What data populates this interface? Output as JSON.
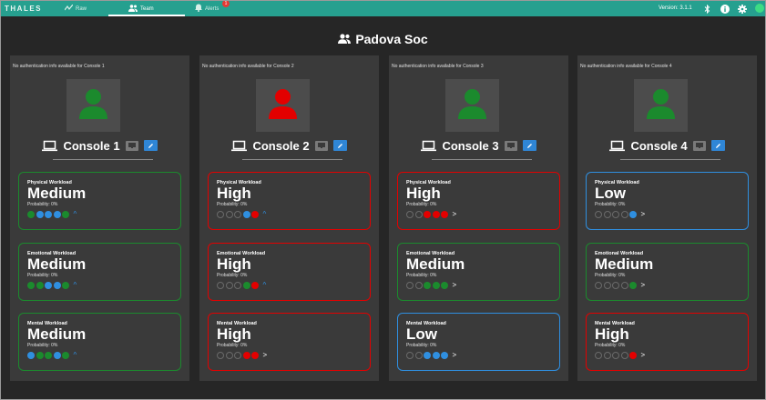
{
  "topbar": {
    "logo": "THALES",
    "tabs": [
      {
        "label": "Raw",
        "icon": "raw-icon"
      },
      {
        "label": "Team",
        "icon": "team-icon"
      },
      {
        "label": "Alerts",
        "icon": "bell-icon",
        "badge": "1"
      }
    ],
    "version": "Version: 3.1.1"
  },
  "page": {
    "title": "Padova Soc"
  },
  "colors": {
    "green": "#1b8a2d",
    "red": "#e30000",
    "blue": "#2f8fe0",
    "accent": "#26a08f"
  },
  "consoles": [
    {
      "auth": "No authentication info available for Console 1",
      "name": "Console 1",
      "avatar_color": "#1b8a2d",
      "workloads": [
        {
          "label": "Physical Workload",
          "value": "Medium",
          "prob": "Probability: 0%",
          "color": "#1b8a2d",
          "dots": [
            "#1b8a2d",
            "#2f8fe0",
            "#2f8fe0",
            "#2f8fe0",
            "#1b8a2d"
          ],
          "trend": "^"
        },
        {
          "label": "Emotional Workload",
          "value": "Medium",
          "prob": "Probability: 0%",
          "color": "#1b8a2d",
          "dots": [
            "#1b8a2d",
            "#1b8a2d",
            "#2f8fe0",
            "#2f8fe0",
            "#1b8a2d"
          ],
          "trend": "^"
        },
        {
          "label": "Mental Workload",
          "value": "Medium",
          "prob": "Probability: 0%",
          "color": "#1b8a2d",
          "dots": [
            "#2f8fe0",
            "#1b8a2d",
            "#1b8a2d",
            "#2f8fe0",
            "#1b8a2d"
          ],
          "trend": "^"
        }
      ]
    },
    {
      "auth": "No authentication info available for Console 2",
      "name": "Console 2",
      "avatar_color": "#e30000",
      "workloads": [
        {
          "label": "Physical Workload",
          "value": "High",
          "prob": "Probability: 0%",
          "color": "#e30000",
          "dots": [
            "off",
            "off",
            "off",
            "#2f8fe0",
            "#e30000"
          ],
          "trend": "^"
        },
        {
          "label": "Emotional Workload",
          "value": "High",
          "prob": "Probability: 0%",
          "color": "#e30000",
          "dots": [
            "off",
            "off",
            "off",
            "#1b8a2d",
            "#e30000"
          ],
          "trend": "^"
        },
        {
          "label": "Mental Workload",
          "value": "High",
          "prob": "Probability: 0%",
          "color": "#e30000",
          "dots": [
            "off",
            "off",
            "off",
            "#e30000",
            "#e30000"
          ],
          "trend": ">"
        }
      ]
    },
    {
      "auth": "No authentication info available for Console 3",
      "name": "Console 3",
      "avatar_color": "#1b8a2d",
      "workloads": [
        {
          "label": "Physical Workload",
          "value": "High",
          "prob": "Probability: 0%",
          "color": "#e30000",
          "dots": [
            "off",
            "off",
            "#e30000",
            "#e30000",
            "#e30000"
          ],
          "trend": ">"
        },
        {
          "label": "Emotional Workload",
          "value": "Medium",
          "prob": "Probability: 0%",
          "color": "#1b8a2d",
          "dots": [
            "off",
            "off",
            "#1b8a2d",
            "#1b8a2d",
            "#1b8a2d"
          ],
          "trend": ">"
        },
        {
          "label": "Mental Workload",
          "value": "Low",
          "prob": "Probability: 0%",
          "color": "#2f8fe0",
          "dots": [
            "off",
            "off",
            "#2f8fe0",
            "#2f8fe0",
            "#2f8fe0"
          ],
          "trend": ">"
        }
      ]
    },
    {
      "auth": "No authentication info available for Console 4",
      "name": "Console 4",
      "avatar_color": "#1b8a2d",
      "workloads": [
        {
          "label": "Physical Workload",
          "value": "Low",
          "prob": "Probability: 0%",
          "color": "#2f8fe0",
          "dots": [
            "off",
            "off",
            "off",
            "off",
            "#2f8fe0"
          ],
          "trend": ">"
        },
        {
          "label": "Emotional Workload",
          "value": "Medium",
          "prob": "Probability: 0%",
          "color": "#1b8a2d",
          "dots": [
            "off",
            "off",
            "off",
            "off",
            "#1b8a2d"
          ],
          "trend": ">"
        },
        {
          "label": "Mental Workload",
          "value": "High",
          "prob": "Probability: 0%",
          "color": "#e30000",
          "dots": [
            "off",
            "off",
            "off",
            "off",
            "#e30000"
          ],
          "trend": ">"
        }
      ]
    }
  ]
}
